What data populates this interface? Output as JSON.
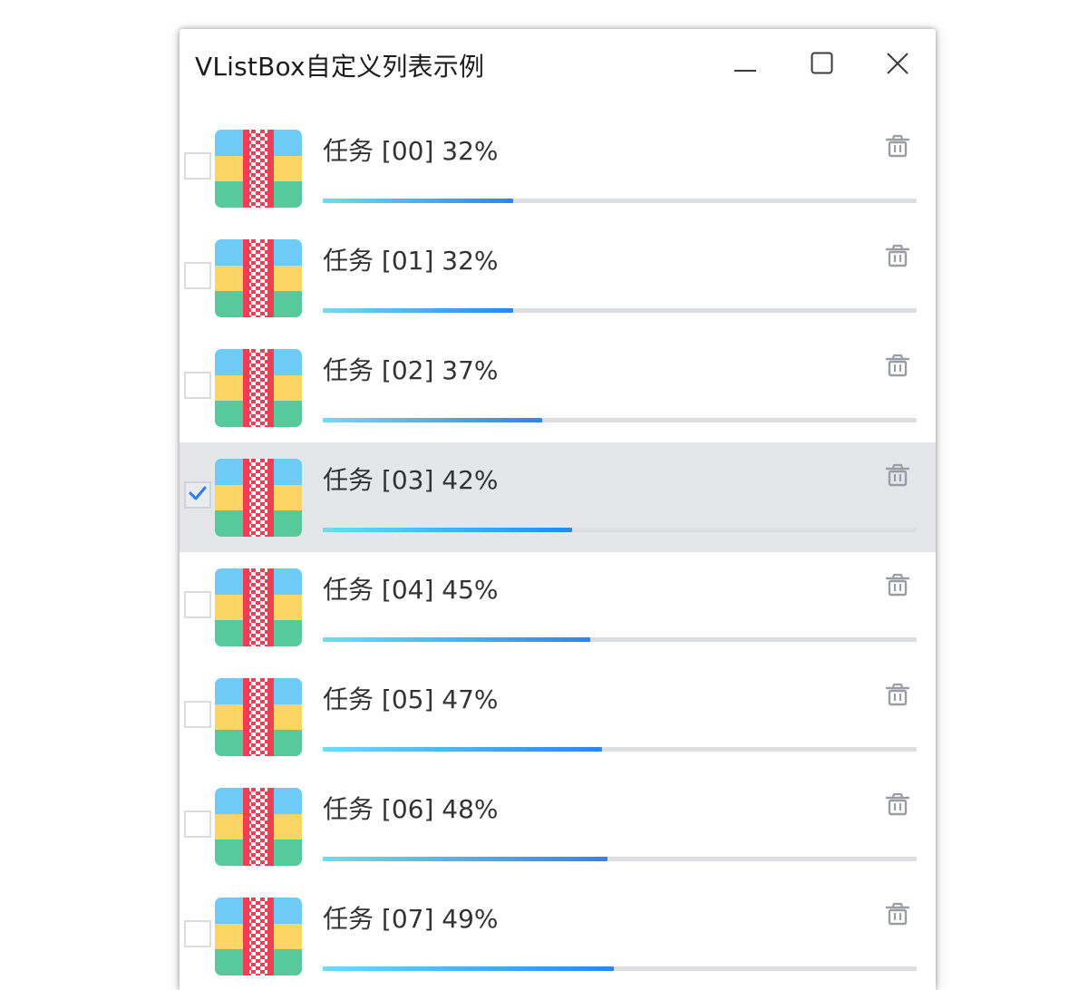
{
  "window": {
    "title": "VListBox自定义列表示例",
    "buttons": {
      "minimize": "minimize-icon",
      "maximize": "maximize-icon",
      "close": "close-icon"
    }
  },
  "colors": {
    "progress_start": "#6fdcf0",
    "progress_end": "#2a86f0",
    "track": "#dcdee2",
    "selected_row": "#e4e6ea",
    "check": "#2a7ff0"
  },
  "tasks": [
    {
      "label": "任务 [00] 32%",
      "progress": 0.32,
      "checked": false,
      "selected": false
    },
    {
      "label": "任务 [01] 32%",
      "progress": 0.32,
      "checked": false,
      "selected": false
    },
    {
      "label": "任务 [02] 37%",
      "progress": 0.37,
      "checked": false,
      "selected": false
    },
    {
      "label": "任务 [03] 42%",
      "progress": 0.42,
      "checked": true,
      "selected": true
    },
    {
      "label": "任务 [04] 45%",
      "progress": 0.45,
      "checked": false,
      "selected": false
    },
    {
      "label": "任务 [05] 47%",
      "progress": 0.47,
      "checked": false,
      "selected": false
    },
    {
      "label": "任务 [06] 48%",
      "progress": 0.48,
      "checked": false,
      "selected": false
    },
    {
      "label": "任务 [07] 49%",
      "progress": 0.49,
      "checked": false,
      "selected": false
    }
  ],
  "row_icons": {
    "file": "archive-file-icon",
    "delete": "trash-icon",
    "check": "checkmark-icon"
  }
}
